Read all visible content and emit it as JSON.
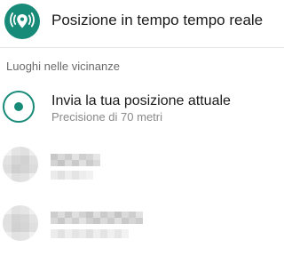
{
  "live_location": {
    "label": "Posizione in tempo tempo reale",
    "icon": "live-location-icon",
    "icon_bg_color": "#178a78"
  },
  "nearby": {
    "header": "Luoghi nelle vicinanze",
    "current_location": {
      "title": "Invia la tua posizione attuale",
      "subtitle": "Precisione di 70 metri",
      "icon": "my-location-icon",
      "accent_color": "#178a78"
    },
    "places": [
      {
        "icon": "blurred-place-icon"
      },
      {
        "icon": "blurred-place-icon"
      }
    ]
  }
}
